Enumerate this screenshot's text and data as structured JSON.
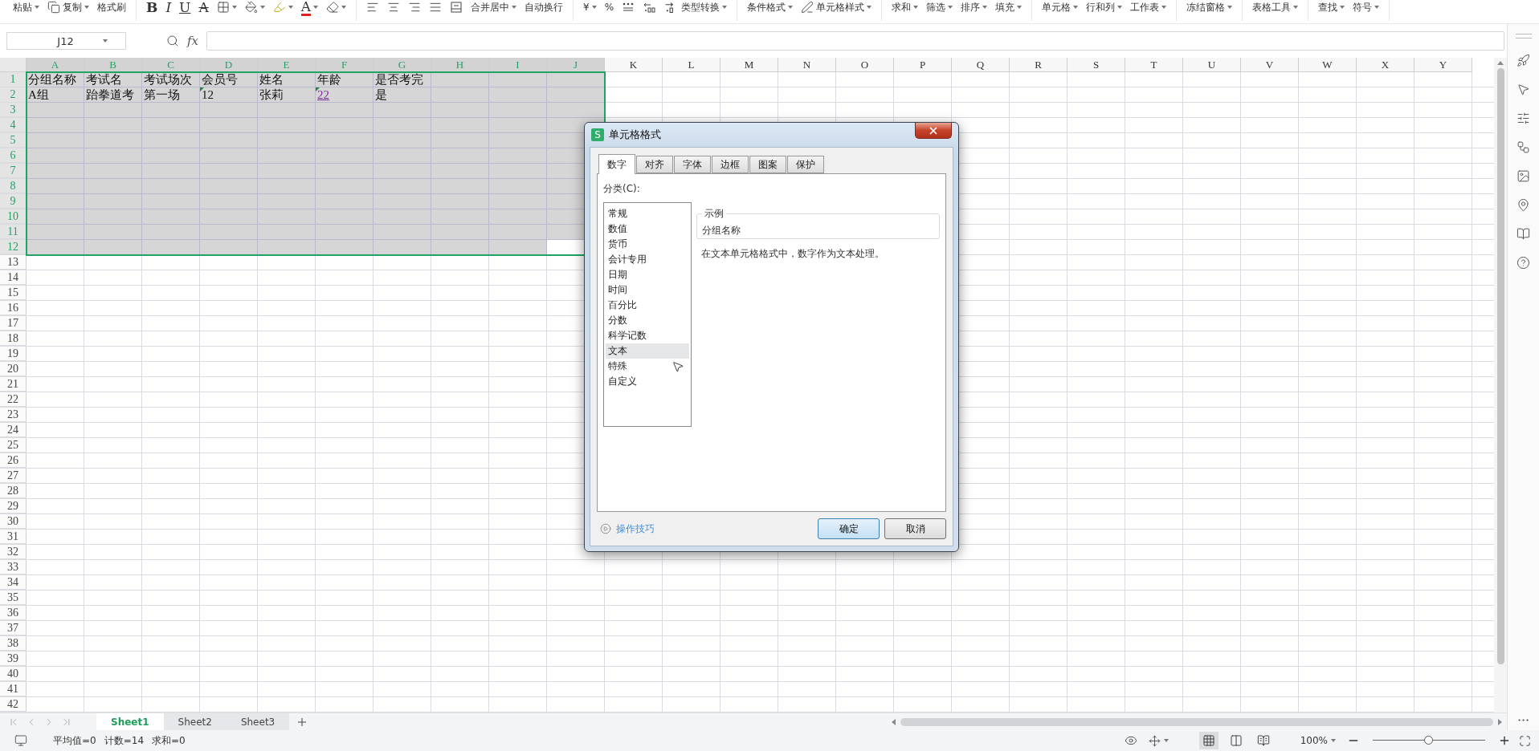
{
  "toolbar": {
    "groups": [
      [
        {
          "kind": "text",
          "label": "粘贴",
          "dropdown": true
        },
        {
          "kind": "copy",
          "label": "复制",
          "dropdown": true
        },
        {
          "kind": "text",
          "label": "格式刷",
          "dropdown": false
        }
      ],
      [
        {
          "kind": "bold",
          "label": "B",
          "dropdown": false
        },
        {
          "kind": "italic",
          "label": "I",
          "dropdown": false
        },
        {
          "kind": "underline",
          "label": "U",
          "dropdown": false
        },
        {
          "kind": "strike",
          "label": "A",
          "dropdown": false
        },
        {
          "kind": "border",
          "dropdown": true
        },
        {
          "kind": "fill",
          "dropdown": true
        },
        {
          "kind": "highlight",
          "dropdown": true
        },
        {
          "kind": "fontcolor",
          "label": "A",
          "dropdown": true
        },
        {
          "kind": "eraser",
          "dropdown": true
        }
      ],
      [
        {
          "kind": "alignleft",
          "dropdown": false
        },
        {
          "kind": "aligncenter",
          "dropdown": false
        },
        {
          "kind": "alignright",
          "dropdown": false
        },
        {
          "kind": "alignjustify",
          "dropdown": false
        },
        {
          "kind": "merge",
          "dropdown": false
        },
        {
          "kind": "text",
          "label": "合并居中",
          "dropdown": true
        },
        {
          "kind": "text",
          "label": "自动换行",
          "dropdown": false
        }
      ],
      [
        {
          "kind": "text",
          "label": "¥",
          "dropdown": true
        },
        {
          "kind": "text",
          "label": "%",
          "dropdown": false
        },
        {
          "kind": "thousands",
          "dropdown": false
        },
        {
          "kind": "adddecimal",
          "dropdown": false
        },
        {
          "kind": "removedecimal",
          "dropdown": false
        },
        {
          "kind": "text",
          "label": "类型转换",
          "dropdown": true
        }
      ],
      [
        {
          "kind": "text",
          "label": "条件格式",
          "dropdown": true
        },
        {
          "kind": "cellstyle",
          "label": "单元格样式",
          "dropdown": true
        }
      ],
      [
        {
          "kind": "text",
          "label": "求和",
          "dropdown": true
        },
        {
          "kind": "text",
          "label": "筛选",
          "dropdown": true
        },
        {
          "kind": "text",
          "label": "排序",
          "dropdown": true
        },
        {
          "kind": "text",
          "label": "填充",
          "dropdown": true
        }
      ],
      [
        {
          "kind": "text",
          "label": "单元格",
          "dropdown": true
        },
        {
          "kind": "text",
          "label": "行和列",
          "dropdown": true
        },
        {
          "kind": "text",
          "label": "工作表",
          "dropdown": true
        }
      ],
      [
        {
          "kind": "text",
          "label": "冻结窗格",
          "dropdown": true
        }
      ],
      [
        {
          "kind": "text",
          "label": "表格工具",
          "dropdown": true
        }
      ],
      [
        {
          "kind": "text",
          "label": "查找",
          "dropdown": true
        },
        {
          "kind": "text",
          "label": "符号",
          "dropdown": true
        }
      ]
    ]
  },
  "formula_bar": {
    "name_box": "J12",
    "fx": "fx"
  },
  "sheet": {
    "columns": [
      {
        "label": "A",
        "selected": true,
        "active": false
      },
      {
        "label": "B",
        "selected": true,
        "active": false
      },
      {
        "label": "C",
        "selected": true,
        "active": false
      },
      {
        "label": "D",
        "selected": true,
        "active": false
      },
      {
        "label": "E",
        "selected": true,
        "active": false
      },
      {
        "label": "F",
        "selected": true,
        "active": false
      },
      {
        "label": "G",
        "selected": true,
        "active": false
      },
      {
        "label": "H",
        "selected": true,
        "active": false
      },
      {
        "label": "I",
        "selected": true,
        "active": false
      },
      {
        "label": "J",
        "selected": true,
        "active": true
      },
      {
        "label": "K",
        "selected": false,
        "active": false
      },
      {
        "label": "L",
        "selected": false,
        "active": false
      },
      {
        "label": "M",
        "selected": false,
        "active": false
      },
      {
        "label": "N",
        "selected": false,
        "active": false
      },
      {
        "label": "O",
        "selected": false,
        "active": false
      },
      {
        "label": "P",
        "selected": false,
        "active": false
      },
      {
        "label": "Q",
        "selected": false,
        "active": false
      },
      {
        "label": "R",
        "selected": false,
        "active": false
      },
      {
        "label": "S",
        "selected": false,
        "active": false
      },
      {
        "label": "T",
        "selected": false,
        "active": false
      },
      {
        "label": "U",
        "selected": false,
        "active": false
      },
      {
        "label": "V",
        "selected": false,
        "active": false
      },
      {
        "label": "W",
        "selected": false,
        "active": false
      },
      {
        "label": "X",
        "selected": false,
        "active": false
      },
      {
        "label": "Y",
        "selected": false,
        "active": false
      }
    ],
    "rows": [
      {
        "label": "1",
        "selected": true,
        "active": false,
        "cells": [
          {
            "text": "分组名称",
            "flag": false,
            "kind": "plain"
          },
          {
            "text": "考试名",
            "flag": false,
            "kind": "plain"
          },
          {
            "text": "考试场次",
            "flag": false,
            "kind": "plain"
          },
          {
            "text": "会员号",
            "flag": false,
            "kind": "plain"
          },
          {
            "text": "姓名",
            "flag": false,
            "kind": "plain"
          },
          {
            "text": "年龄",
            "flag": false,
            "kind": "plain"
          },
          {
            "text": "是否考完",
            "flag": false,
            "kind": "plain"
          }
        ]
      },
      {
        "label": "2",
        "selected": true,
        "active": false,
        "cells": [
          {
            "text": "A组",
            "flag": false,
            "kind": "plain"
          },
          {
            "text": "跆拳道考",
            "flag": false,
            "kind": "plain"
          },
          {
            "text": "第一场",
            "flag": false,
            "kind": "plain"
          },
          {
            "text": "12",
            "flag": true,
            "kind": "plain"
          },
          {
            "text": "张莉",
            "flag": false,
            "kind": "plain"
          },
          {
            "text": "22",
            "flag": true,
            "kind": "link"
          },
          {
            "text": "是",
            "flag": false,
            "kind": "plain"
          }
        ]
      },
      {
        "label": "3",
        "selected": true,
        "active": false
      },
      {
        "label": "4",
        "selected": true,
        "active": false
      },
      {
        "label": "5",
        "selected": true,
        "active": false
      },
      {
        "label": "6",
        "selected": true,
        "active": false
      },
      {
        "label": "7",
        "selected": true,
        "active": false
      },
      {
        "label": "8",
        "selected": true,
        "active": false
      },
      {
        "label": "9",
        "selected": true,
        "active": false
      },
      {
        "label": "10",
        "selected": true,
        "active": false
      },
      {
        "label": "11",
        "selected": true,
        "active": false
      },
      {
        "label": "12",
        "selected": true,
        "active": true
      },
      {
        "label": "13",
        "selected": false,
        "active": false
      },
      {
        "label": "14",
        "selected": false,
        "active": false
      },
      {
        "label": "15",
        "selected": false,
        "active": false
      },
      {
        "label": "16",
        "selected": false,
        "active": false
      },
      {
        "label": "17",
        "selected": false,
        "active": false
      },
      {
        "label": "18",
        "selected": false,
        "active": false
      },
      {
        "label": "19",
        "selected": false,
        "active": false
      },
      {
        "label": "20",
        "selected": false,
        "active": false
      },
      {
        "label": "21",
        "selected": false,
        "active": false
      },
      {
        "label": "22",
        "selected": false,
        "active": false
      },
      {
        "label": "23",
        "selected": false,
        "active": false
      },
      {
        "label": "24",
        "selected": false,
        "active": false
      },
      {
        "label": "25",
        "selected": false,
        "active": false
      },
      {
        "label": "26",
        "selected": false,
        "active": false
      },
      {
        "label": "27",
        "selected": false,
        "active": false
      },
      {
        "label": "28",
        "selected": false,
        "active": false
      },
      {
        "label": "29",
        "selected": false,
        "active": false
      },
      {
        "label": "30",
        "selected": false,
        "active": false
      },
      {
        "label": "31",
        "selected": false,
        "active": false
      },
      {
        "label": "32",
        "selected": false,
        "active": false
      },
      {
        "label": "33",
        "selected": false,
        "active": false
      },
      {
        "label": "34",
        "selected": false,
        "active": false
      },
      {
        "label": "35",
        "selected": false,
        "active": false
      },
      {
        "label": "36",
        "selected": false,
        "active": false
      },
      {
        "label": "37",
        "selected": false,
        "active": false
      },
      {
        "label": "38",
        "selected": false,
        "active": false
      },
      {
        "label": "39",
        "selected": false,
        "active": false
      },
      {
        "label": "40",
        "selected": false,
        "active": false
      },
      {
        "label": "41",
        "selected": false,
        "active": false
      },
      {
        "label": "42",
        "selected": false,
        "active": false
      }
    ]
  },
  "dialog": {
    "logo": "S",
    "title": "单元格格式",
    "tabs": [
      {
        "label": "数字",
        "selected": true
      },
      {
        "label": "对齐",
        "selected": false
      },
      {
        "label": "字体",
        "selected": false
      },
      {
        "label": "边框",
        "selected": false
      },
      {
        "label": "图案",
        "selected": false
      },
      {
        "label": "保护",
        "selected": false
      }
    ],
    "category_label": "分类(C):",
    "categories": [
      {
        "label": "常规",
        "selected": false
      },
      {
        "label": "数值",
        "selected": false
      },
      {
        "label": "货币",
        "selected": false
      },
      {
        "label": "会计专用",
        "selected": false
      },
      {
        "label": "日期",
        "selected": false
      },
      {
        "label": "时间",
        "selected": false
      },
      {
        "label": "百分比",
        "selected": false
      },
      {
        "label": "分数",
        "selected": false
      },
      {
        "label": "科学记数",
        "selected": false
      },
      {
        "label": "文本",
        "selected": true
      },
      {
        "label": "特殊",
        "selected": false
      },
      {
        "label": "自定义",
        "selected": false
      }
    ],
    "sample_label": "示例",
    "sample": "分组名称",
    "description": "在文本单元格格式中，数字作为文本处理。",
    "tips_link": "操作技巧",
    "buttons": [
      {
        "label": "确定",
        "default": true
      },
      {
        "label": "取消",
        "default": false
      }
    ]
  },
  "sheet_tabs": [
    {
      "label": "Sheet1",
      "selected": true
    },
    {
      "label": "Sheet2",
      "selected": false
    },
    {
      "label": "Sheet3",
      "selected": false
    }
  ],
  "status_bar": {
    "stats": [
      "平均值=0",
      "计数=14",
      "求和=0"
    ],
    "views": [
      {
        "kind": "normal",
        "selected": true
      },
      {
        "kind": "reading",
        "selected": false
      },
      {
        "kind": "page",
        "selected": false
      }
    ],
    "zoom": "100%",
    "zoom_slider": {
      "level": 0.5
    }
  }
}
